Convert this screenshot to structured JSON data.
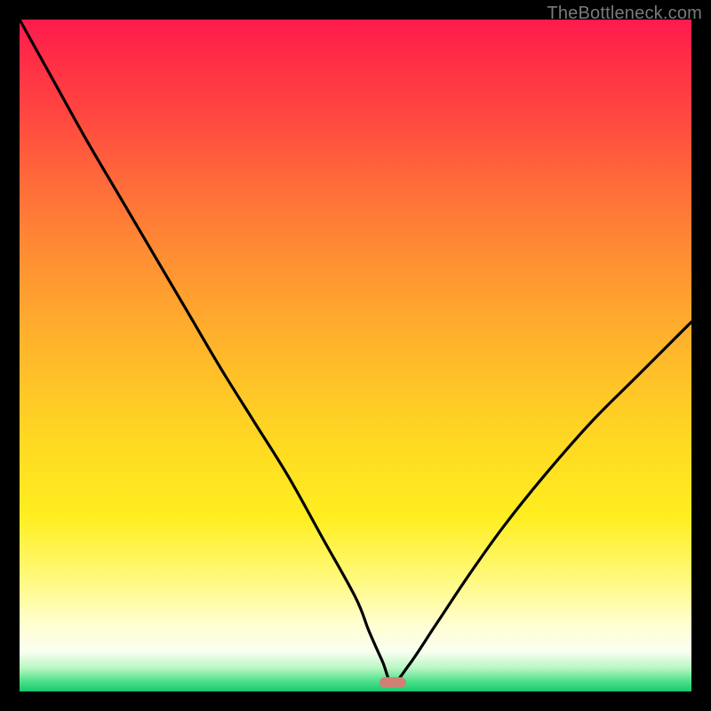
{
  "watermark": "TheBottleneck.com",
  "marker_color": "#cf8173",
  "chart_data": {
    "type": "line",
    "title": "",
    "xlabel": "",
    "ylabel": "",
    "xlim": [
      0,
      100
    ],
    "ylim": [
      0,
      100
    ],
    "grid": false,
    "legend": false,
    "series": [
      {
        "name": "bottleneck-curve",
        "x": [
          0,
          5,
          10,
          15,
          20,
          25,
          30,
          35,
          40,
          45,
          50,
          52,
          54,
          55.5,
          58,
          62,
          67,
          72,
          78,
          85,
          92,
          100
        ],
        "y": [
          100,
          91,
          82,
          73.5,
          65,
          56.5,
          48,
          40,
          32,
          23,
          14,
          9,
          4.5,
          1.3,
          4,
          10,
          17.5,
          24.5,
          32,
          40,
          47,
          55
        ]
      }
    ],
    "annotations": [
      {
        "name": "bottleneck-minimum-marker",
        "x": 55.5,
        "y": 1.3,
        "shape": "pill",
        "color_ref": "marker_color"
      }
    ],
    "background_gradient_stops": [
      {
        "pos": 0.0,
        "color": "#ff1a4d"
      },
      {
        "pos": 0.24,
        "color": "#ff6a3a"
      },
      {
        "pos": 0.54,
        "color": "#ffc328"
      },
      {
        "pos": 0.83,
        "color": "#fff97a"
      },
      {
        "pos": 0.94,
        "color": "#fafff0"
      },
      {
        "pos": 1.0,
        "color": "#18c86e"
      }
    ]
  }
}
